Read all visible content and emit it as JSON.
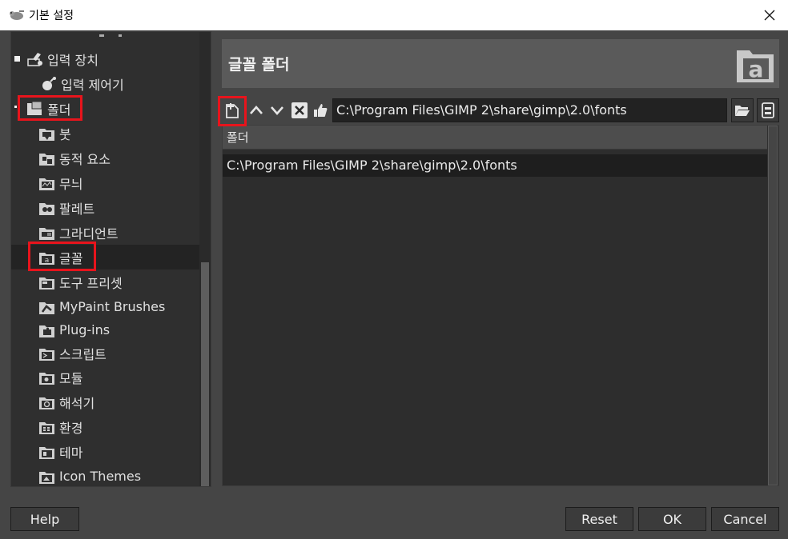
{
  "window": {
    "title": "기본 설정",
    "close_icon": "close-icon"
  },
  "tree": {
    "items": [
      {
        "label": "입력 장치",
        "icon": "input-devices-icon",
        "expanded": true
      },
      {
        "label": "입력 제어기",
        "icon": "input-controller-icon"
      },
      {
        "label": "폴더",
        "icon": "folder-icon",
        "expanded": true
      },
      {
        "label": "붓",
        "icon": "brush-folder-icon"
      },
      {
        "label": "동적 요소",
        "icon": "dynamics-folder-icon"
      },
      {
        "label": "무늬",
        "icon": "pattern-folder-icon"
      },
      {
        "label": "팔레트",
        "icon": "palette-folder-icon"
      },
      {
        "label": "그라디언트",
        "icon": "gradient-folder-icon"
      },
      {
        "label": "글꼴",
        "icon": "font-folder-icon",
        "selected": true
      },
      {
        "label": "도구 프리셋",
        "icon": "tool-preset-folder-icon"
      },
      {
        "label": "MyPaint Brushes",
        "icon": "mypaint-folder-icon"
      },
      {
        "label": "Plug-ins",
        "icon": "plugin-folder-icon"
      },
      {
        "label": "스크립트",
        "icon": "script-folder-icon"
      },
      {
        "label": "모듈",
        "icon": "module-folder-icon"
      },
      {
        "label": "해석기",
        "icon": "interpreter-folder-icon"
      },
      {
        "label": "환경",
        "icon": "environment-folder-icon"
      },
      {
        "label": "테마",
        "icon": "theme-folder-icon"
      },
      {
        "label": "Icon Themes",
        "icon": "icon-theme-folder-icon"
      }
    ]
  },
  "main": {
    "title": "글꼴 폴더",
    "path_value": "C:\\Program Files\\GIMP 2\\share\\gimp\\2.0\\fonts",
    "column_header": "폴더",
    "folders": [
      "C:\\Program Files\\GIMP 2\\share\\gimp\\2.0\\fonts"
    ]
  },
  "buttons": {
    "help": "Help",
    "reset": "Reset",
    "ok": "OK",
    "cancel": "Cancel"
  },
  "colors": {
    "highlight": "#e8141c",
    "background": "#454545"
  }
}
